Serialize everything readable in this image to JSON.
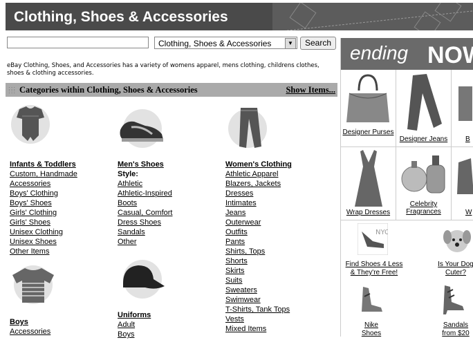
{
  "header": {
    "title": "Clothing, Shoes & Accessories"
  },
  "search": {
    "value": "",
    "category": "Clothing, Shoes & Accessories",
    "button": "Search"
  },
  "description": "eBay Clothing, Shoes, and Accessories has a variety of womens apparel, mens clothing, childrens clothes, shoes & clothing accessories.",
  "categories_bar": {
    "title": "Categories within Clothing, Shoes & Accessories",
    "show_items": "Show Items..."
  },
  "columns": {
    "infants": {
      "title": "Infants & Toddlers",
      "items": [
        "Custom, Handmade",
        "Accessories",
        "Boys' Clothing",
        "Boys' Shoes",
        "Girls' Clothing",
        "Girls' Shoes",
        "Unisex Clothing",
        "Unisex Shoes",
        "Other Items"
      ]
    },
    "boys": {
      "title": "Boys",
      "items": [
        "Accessories"
      ]
    },
    "mens_shoes": {
      "title": "Men's Shoes",
      "style_label": "Style:",
      "items": [
        "Athletic",
        "Athletic-Inspired",
        "Boots",
        "Casual, Comfort",
        "Dress Shoes",
        "Sandals",
        "Other"
      ]
    },
    "uniforms": {
      "title": "Uniforms",
      "items": [
        "Adult",
        "Boys"
      ]
    },
    "womens": {
      "title": "Women's Clothing",
      "items": [
        "Athletic Apparel",
        "Blazers, Jackets",
        "Dresses",
        "Intimates",
        "Jeans",
        "Outerwear",
        "Outfits",
        "Pants",
        "Shirts, Tops",
        "Shorts",
        "Skirts",
        "Suits",
        "Sweaters",
        "Swimwear",
        "T-Shirts, Tank Tops",
        "Vests",
        "Mixed Items"
      ]
    }
  },
  "right_panel": {
    "banner": {
      "word1": "ending",
      "word2": "NOW"
    },
    "cells": [
      {
        "label": "Designer Purses"
      },
      {
        "label": "Designer Jeans"
      },
      {
        "label": "B"
      },
      {
        "label": "Wrap Dresses"
      },
      {
        "label": "Celebrity Fragrances"
      },
      {
        "label": "W"
      }
    ],
    "promos": [
      {
        "line1": "Find Shoes 4 Less",
        "line2": "& They're Free!",
        "badge": "NYC"
      },
      {
        "line1": "Is Your Dog",
        "line2": "Cuter?"
      },
      {
        "line1": "Nike",
        "line2": "Shoes"
      },
      {
        "line1": "Sandals",
        "line2": "from $20"
      }
    ]
  }
}
